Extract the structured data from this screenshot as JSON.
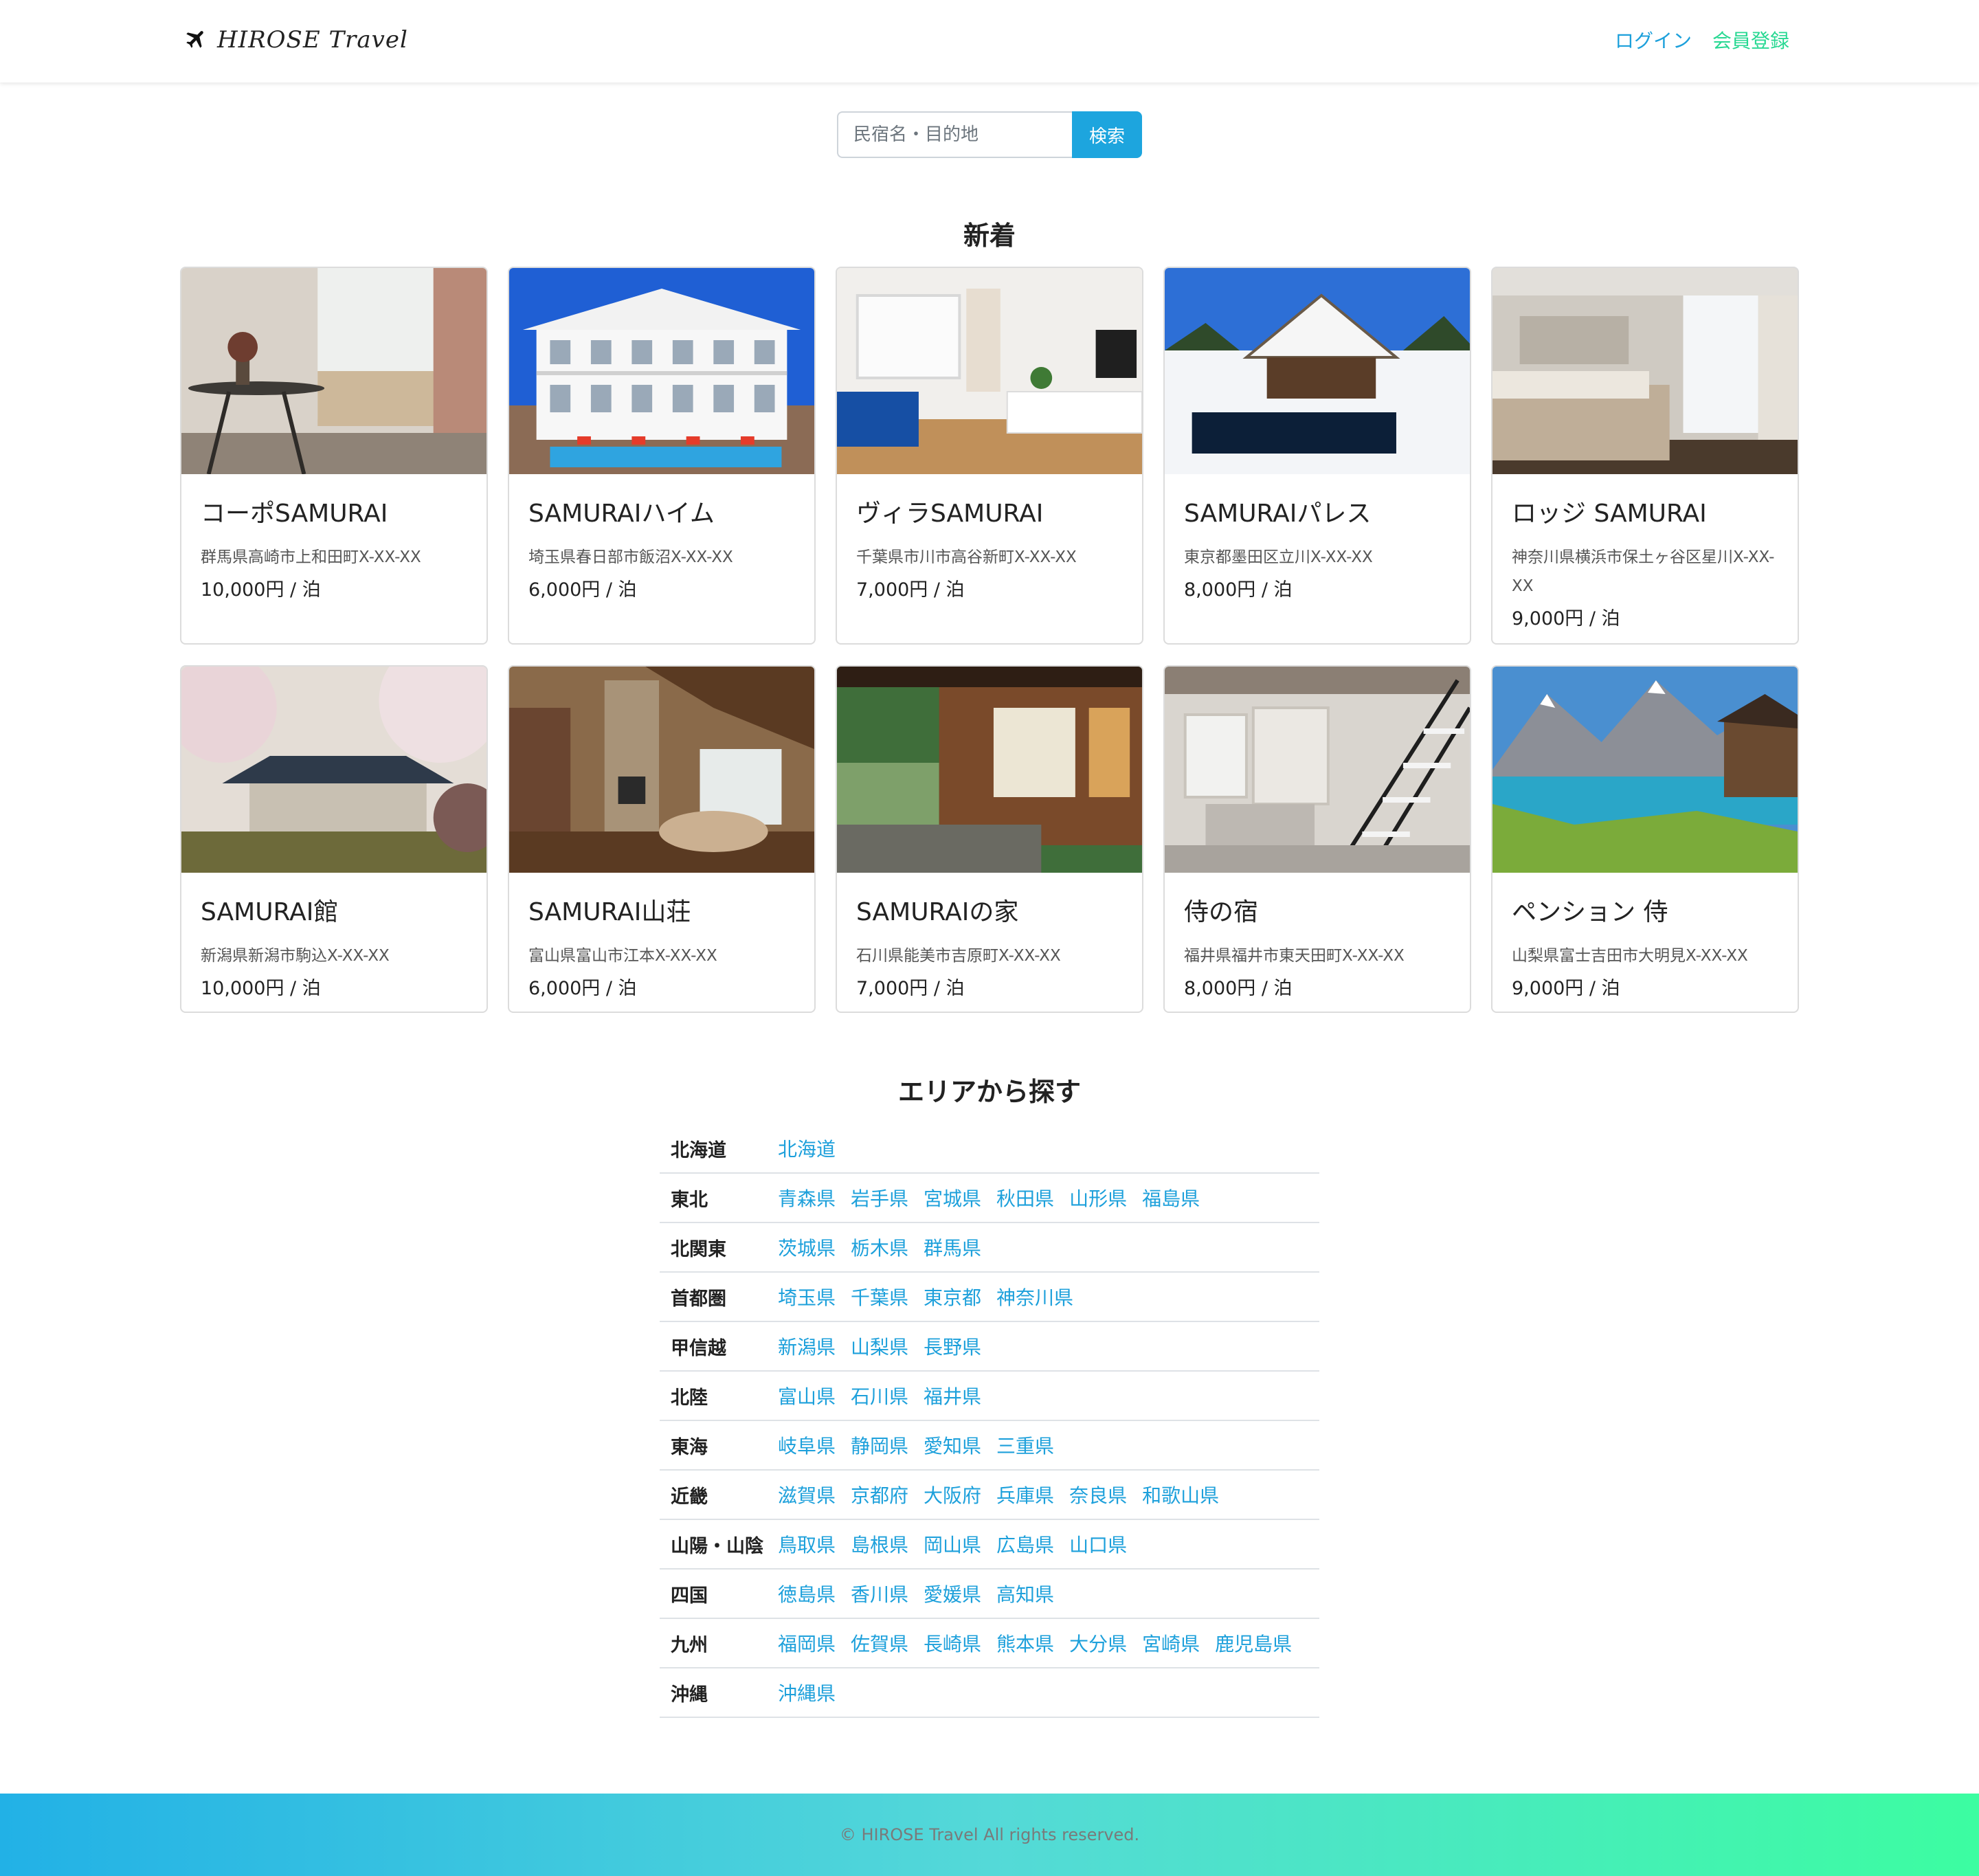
{
  "header": {
    "logo_text": "HIROSE Travel",
    "login": "ログイン",
    "signup": "会員登録"
  },
  "search": {
    "placeholder": "民宿名・目的地",
    "button": "検索"
  },
  "new_section": {
    "title": "新着",
    "cards": [
      {
        "name": "コーポSAMURAI",
        "address": "群馬県高崎市上和田町X-XX-XX",
        "price": "10,000円 / 泊",
        "image": "room-with-window-view"
      },
      {
        "name": "SAMURAIハイム",
        "address": "埼玉県春日部市飯沼X-XX-XX",
        "price": "6,000円 / 泊",
        "image": "white-mansion-with-pool"
      },
      {
        "name": "ヴィラSAMURAI",
        "address": "千葉県市川市高谷新町X-XX-XX",
        "price": "7,000円 / 泊",
        "image": "bright-living-room"
      },
      {
        "name": "SAMURAIパレス",
        "address": "東京都墨田区立川X-XX-XX",
        "price": "8,000円 / 泊",
        "image": "snowy-thatched-house"
      },
      {
        "name": "ロッジ SAMURAI",
        "address": "神奈川県横浜市保土ヶ谷区星川X-XX-XX",
        "price": "9,000円 / 泊",
        "image": "hotel-bedroom"
      },
      {
        "name": "SAMURAI館",
        "address": "新潟県新潟市駒込X-XX-XX",
        "price": "10,000円 / 泊",
        "image": "temple-with-cherry-blossoms"
      },
      {
        "name": "SAMURAI山荘",
        "address": "富山県富山市江本X-XX-XX",
        "price": "6,000円 / 泊",
        "image": "cabin-living-room"
      },
      {
        "name": "SAMURAIの家",
        "address": "石川県能美市吉原町X-XX-XX",
        "price": "7,000円 / 泊",
        "image": "japanese-house-garden"
      },
      {
        "name": "侍の宿",
        "address": "福井県福井市東天田町X-XX-XX",
        "price": "8,000円 / 泊",
        "image": "loft-with-staircase"
      },
      {
        "name": "ペンション 侍",
        "address": "山梨県富士吉田市大明見X-XX-XX",
        "price": "9,000円 / 泊",
        "image": "alpine-lake"
      }
    ]
  },
  "area_section": {
    "title": "エリアから探す",
    "rows": [
      {
        "region": "北海道",
        "prefs": [
          "北海道"
        ]
      },
      {
        "region": "東北",
        "prefs": [
          "青森県",
          "岩手県",
          "宮城県",
          "秋田県",
          "山形県",
          "福島県"
        ]
      },
      {
        "region": "北関東",
        "prefs": [
          "茨城県",
          "栃木県",
          "群馬県"
        ]
      },
      {
        "region": "首都圏",
        "prefs": [
          "埼玉県",
          "千葉県",
          "東京都",
          "神奈川県"
        ]
      },
      {
        "region": "甲信越",
        "prefs": [
          "新潟県",
          "山梨県",
          "長野県"
        ]
      },
      {
        "region": "北陸",
        "prefs": [
          "富山県",
          "石川県",
          "福井県"
        ]
      },
      {
        "region": "東海",
        "prefs": [
          "岐阜県",
          "静岡県",
          "愛知県",
          "三重県"
        ]
      },
      {
        "region": "近畿",
        "prefs": [
          "滋賀県",
          "京都府",
          "大阪府",
          "兵庫県",
          "奈良県",
          "和歌山県"
        ]
      },
      {
        "region": "山陽・山陰",
        "prefs": [
          "鳥取県",
          "島根県",
          "岡山県",
          "広島県",
          "山口県"
        ]
      },
      {
        "region": "四国",
        "prefs": [
          "徳島県",
          "香川県",
          "愛媛県",
          "高知県"
        ]
      },
      {
        "region": "九州",
        "prefs": [
          "福岡県",
          "佐賀県",
          "長崎県",
          "熊本県",
          "大分県",
          "宮崎県",
          "鹿児島県"
        ]
      },
      {
        "region": "沖縄",
        "prefs": [
          "沖縄県"
        ]
      }
    ]
  },
  "footer": {
    "copyright": "© HIROSE Travel All rights reserved."
  },
  "colors": {
    "link": "#1da0db",
    "signup": "#27d892",
    "search_button": "#1da5de",
    "footer_gradient_start": "#22b1e6",
    "footer_gradient_end": "#3cfda1"
  }
}
